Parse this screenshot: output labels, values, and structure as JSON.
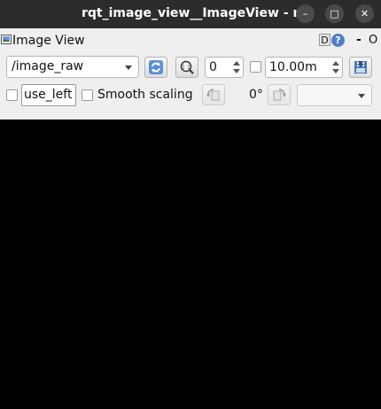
{
  "window": {
    "title": "rqt_image_view__ImageView - rqt",
    "minimize_glyph": "–",
    "maximize_glyph": "□",
    "close_glyph": "✕"
  },
  "dock": {
    "title": "Image View",
    "d_label": "D",
    "help_label": "?",
    "minus_label": "-",
    "o_label": "O"
  },
  "toolbar": {
    "topic": "/image_raw",
    "refresh_icon": "refresh-icon",
    "zoom_icon": "zoom-icon",
    "zoom_value": "0",
    "dynamic_range_checked": false,
    "max_depth": "10.00m",
    "save_icon": "save-icon"
  },
  "options": {
    "mouse_publish_checked": false,
    "mouse_topic": "use_left",
    "smooth_scaling_checked": false,
    "smooth_scaling_label": "Smooth scaling",
    "rotation": "0°",
    "rotate_left_icon": "rotate-left-icon",
    "rotate_right_icon": "rotate-right-icon",
    "color_scheme": ""
  },
  "colors": {
    "titlebar": "#2c2c2c",
    "panel": "#efefef",
    "image_background": "#000000",
    "accent_blue": "#4e7fc8"
  }
}
